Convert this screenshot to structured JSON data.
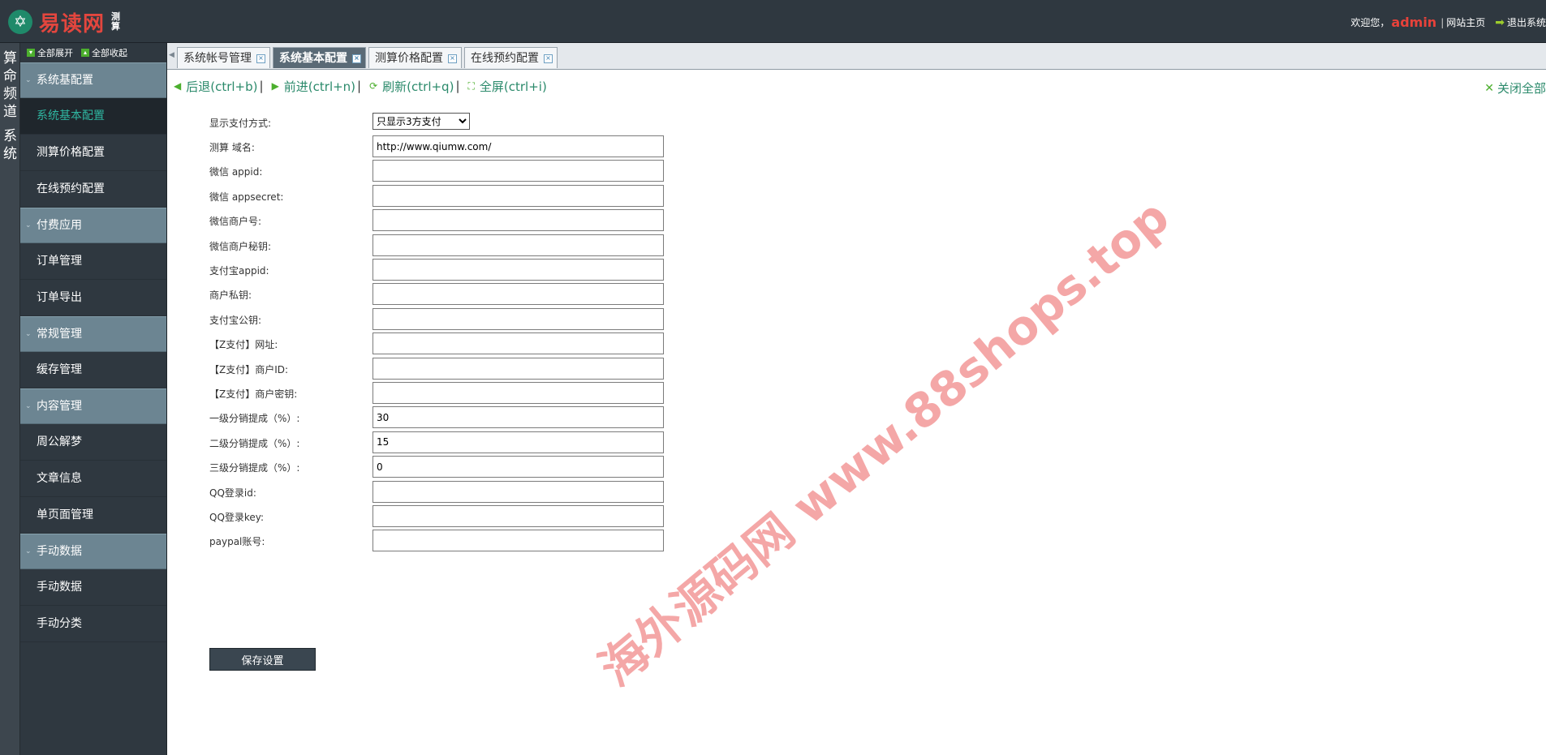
{
  "header": {
    "logo_text": "易读网",
    "logo_sub": "测算",
    "welcome": "欢迎您，",
    "username": "admin",
    "site_home": "网站主页",
    "logout": "退出系统"
  },
  "channels": [
    "算命频道",
    "系统"
  ],
  "sidebar": {
    "expand_all": "全部展开",
    "collapse_all": "全部收起",
    "menu": [
      {
        "type": "group",
        "label": "系统基配置"
      },
      {
        "type": "item",
        "label": "系统基本配置",
        "active": true
      },
      {
        "type": "item",
        "label": "测算价格配置"
      },
      {
        "type": "item",
        "label": "在线预约配置"
      },
      {
        "type": "group",
        "label": "付费应用"
      },
      {
        "type": "item",
        "label": "订单管理"
      },
      {
        "type": "item",
        "label": "订单导出"
      },
      {
        "type": "group",
        "label": "常规管理"
      },
      {
        "type": "item",
        "label": "缓存管理"
      },
      {
        "type": "group",
        "label": "内容管理"
      },
      {
        "type": "item",
        "label": "周公解梦"
      },
      {
        "type": "item",
        "label": "文章信息"
      },
      {
        "type": "item",
        "label": "单页面管理"
      },
      {
        "type": "group",
        "label": "手动数据"
      },
      {
        "type": "item",
        "label": "手动数据"
      },
      {
        "type": "item",
        "label": "手动分类"
      }
    ]
  },
  "tabs": [
    {
      "label": "系统帐号管理"
    },
    {
      "label": "系统基本配置",
      "active": true
    },
    {
      "label": "测算价格配置"
    },
    {
      "label": "在线预约配置"
    }
  ],
  "nav": {
    "back": "后退(ctrl+b)",
    "forward": "前进(ctrl+n)",
    "refresh": "刷新(ctrl+q)",
    "fullscreen": "全屏(ctrl+i)",
    "close_all": "关闭全部"
  },
  "form": {
    "pay_mode_label": "显示支付方式:",
    "pay_mode_value": "只显示3方支付",
    "fields": [
      {
        "label": "测算 域名:",
        "value": "http://www.qiumw.com/"
      },
      {
        "label": "微信 appid:",
        "value": ""
      },
      {
        "label": "微信 appsecret:",
        "value": ""
      },
      {
        "label": "微信商户号:",
        "value": ""
      },
      {
        "label": "微信商户秘钥:",
        "value": ""
      },
      {
        "label": "支付宝appid:",
        "value": ""
      },
      {
        "label": "商户私钥:",
        "value": ""
      },
      {
        "label": "支付宝公钥:",
        "value": ""
      },
      {
        "label": "【Z支付】网址:",
        "value": ""
      },
      {
        "label": "【Z支付】商户ID:",
        "value": ""
      },
      {
        "label": "【Z支付】商户密钥:",
        "value": ""
      },
      {
        "label": "一级分销提成（%）:",
        "value": "30"
      },
      {
        "label": "二级分销提成（%）:",
        "value": "15"
      },
      {
        "label": "三级分销提成（%）:",
        "value": "0"
      },
      {
        "label": "QQ登录id:",
        "value": ""
      },
      {
        "label": "QQ登录key:",
        "value": ""
      },
      {
        "label": "paypal账号:",
        "value": ""
      }
    ],
    "save_label": "保存设置"
  },
  "watermark": "海外源码网 www.88shops.top"
}
